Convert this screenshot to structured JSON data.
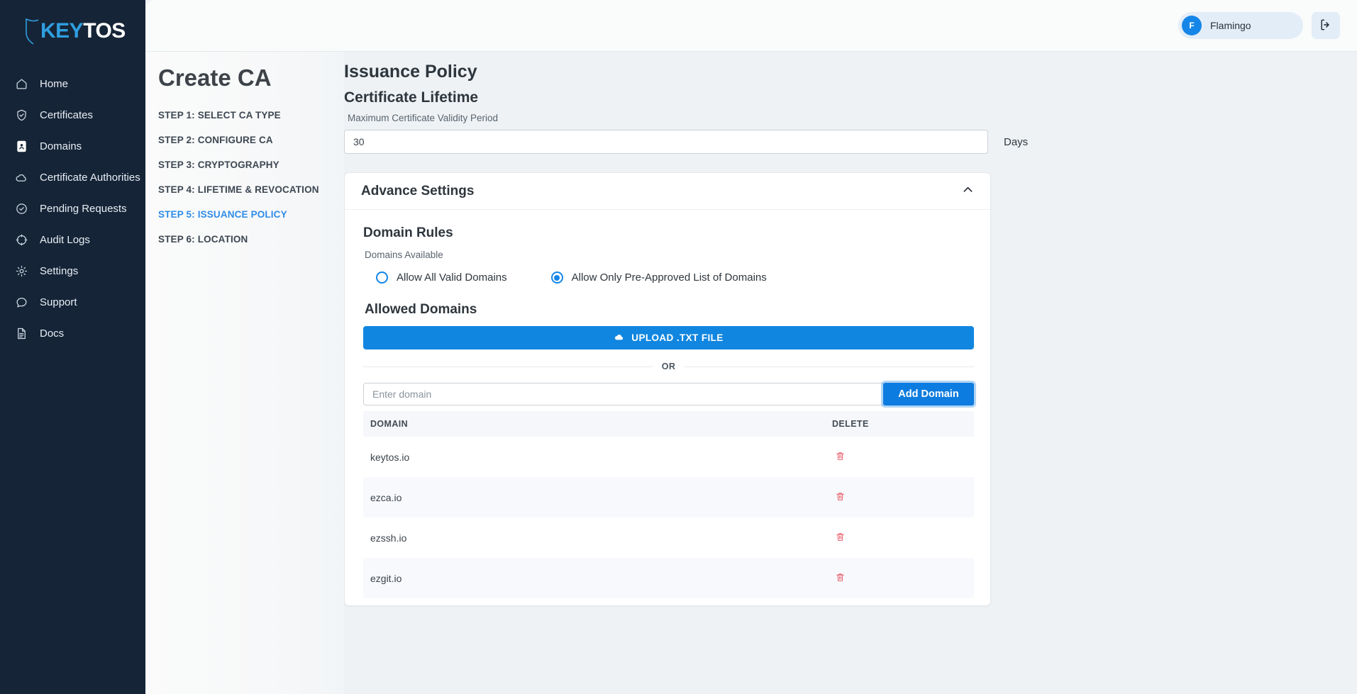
{
  "brand": {
    "logo_key": "KEY",
    "logo_tos": "TOS",
    "accent_blue": "#2f9fe0",
    "sidebar_bg": "#152437"
  },
  "sidebar": {
    "items": [
      {
        "label": "Home",
        "icon": "home-icon",
        "active": false
      },
      {
        "label": "Certificates",
        "icon": "shield-check-icon",
        "active": false
      },
      {
        "label": "Domains",
        "icon": "contact-book-icon",
        "active": true
      },
      {
        "label": "Certificate Authorities",
        "icon": "cloud-icon",
        "active": false
      },
      {
        "label": "Pending Requests",
        "icon": "circle-check-icon",
        "active": false
      },
      {
        "label": "Audit Logs",
        "icon": "crosshair-icon",
        "active": false
      },
      {
        "label": "Settings",
        "icon": "gear-icon",
        "active": false
      },
      {
        "label": "Support",
        "icon": "chat-bubble-icon",
        "active": false
      },
      {
        "label": "Docs",
        "icon": "document-icon",
        "active": false
      }
    ]
  },
  "topbar": {
    "user_initial": "F",
    "user_name": "Flamingo",
    "logout_icon": "logout-icon"
  },
  "page": {
    "title": "Create CA",
    "steps": [
      {
        "label": "STEP 1: SELECT CA TYPE",
        "active": false
      },
      {
        "label": "STEP 2: CONFIGURE CA",
        "active": false
      },
      {
        "label": "STEP 3: CRYPTOGRAPHY",
        "active": false
      },
      {
        "label": "STEP 4: LIFETIME & REVOCATION",
        "active": false
      },
      {
        "label": "STEP 5: ISSUANCE POLICY",
        "active": true
      },
      {
        "label": "STEP 6: LOCATION",
        "active": false
      }
    ]
  },
  "issuance": {
    "heading": "Issuance Policy",
    "lifetime_heading": "Certificate Lifetime",
    "validity_label": "Maximum Certificate Validity Period",
    "validity_value": "30",
    "validity_unit": "Days"
  },
  "advance": {
    "title": "Advance Settings",
    "collapse_icon": "chevron-up-icon",
    "expanded": true,
    "domain_rules_heading": "Domain Rules",
    "domains_available_label": "Domains Available",
    "radio_options": [
      {
        "label": "Allow All Valid Domains",
        "selected": false
      },
      {
        "label": "Allow Only Pre-Approved List of Domains",
        "selected": true
      }
    ],
    "allowed_domains_heading": "Allowed Domains",
    "upload_button_label": "UPLOAD .TXT FILE",
    "upload_icon": "cloud-upload-icon",
    "or_divider": "OR",
    "domain_input_placeholder": "Enter domain",
    "domain_input_value": "",
    "add_domain_button": "Add Domain",
    "table": {
      "columns": [
        "DOMAIN",
        "DELETE"
      ],
      "rows": [
        {
          "domain": "keytos.io",
          "delete_icon": "trash-icon"
        },
        {
          "domain": "ezca.io",
          "delete_icon": "trash-icon"
        },
        {
          "domain": "ezssh.io",
          "delete_icon": "trash-icon"
        },
        {
          "domain": "ezgit.io",
          "delete_icon": "trash-icon"
        }
      ]
    }
  }
}
